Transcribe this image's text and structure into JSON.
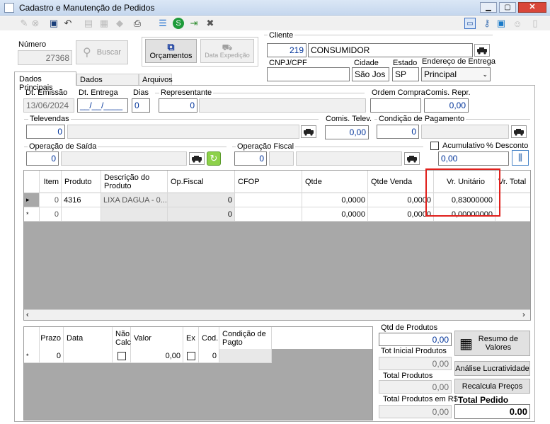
{
  "window": {
    "title": "Cadastro e Manutenção de Pedidos"
  },
  "search": {
    "numero_label": "Número",
    "numero_value": "27368",
    "buscar_label": "Buscar",
    "orcamentos_label": "Orçamentos",
    "data_expedicao_label": "Data Expedição"
  },
  "cliente": {
    "label": "Cliente",
    "code": "219",
    "name": "CONSUMIDOR",
    "cnpj_label": "CNPJ/CPF",
    "cnpj_value": "",
    "cidade_label": "Cidade",
    "cidade_value": "São Jos",
    "estado_label": "Estado",
    "estado_value": "SP",
    "endereco_label": "Endereço de Entrega",
    "endereco_value": "Principal"
  },
  "tabs": [
    "Dados Principais",
    "Dados Adicionais",
    "Arquivos"
  ],
  "form": {
    "dt_emissao_label": "Dt. Emissão",
    "dt_emissao": "13/06/2024",
    "dt_entrega_label": "Dt. Entrega",
    "dt_entrega": "__/__/____",
    "dias_label": "Dias",
    "dias": "0",
    "representante_label": "Representante",
    "representante": "0",
    "ordem_compra_label": "Ordem Compra",
    "ordem_compra": "",
    "comis_repr_label": "Comis. Repr.",
    "comis_repr": "0,00",
    "televendas_label": "Televendas",
    "televendas": "0",
    "comis_telev_label": "Comis. Telev.",
    "comis_telev": "0,00",
    "cond_pag_label": "Condição de Pagamento",
    "cond_pag": "0",
    "op_saida_label": "Operação de Saída",
    "op_saida": "0",
    "op_fiscal_label": "Operação Fiscal",
    "op_fiscal": "0",
    "acumulativo_label": "Acumulativo",
    "desconto_label": "% Desconto",
    "desconto": "0,00"
  },
  "items_grid": {
    "headers": [
      "Item",
      "Produto",
      "Descrição do Produto",
      "Op.Fiscal",
      "CFOP",
      "Qtde",
      "Qtde Venda",
      "Vr. Unitário",
      "Vr. Total"
    ],
    "rows": [
      {
        "marker": "▸",
        "item": "0",
        "produto": "4316",
        "descricao": "LIXA DAGUA - 0...",
        "opfiscal": "0",
        "cfop": "",
        "qtde": "0,0000",
        "qtde_venda": "0,0000",
        "vr_unit": "0,83000000",
        "vr_total": ""
      },
      {
        "marker": "*",
        "item": "0",
        "produto": "",
        "descricao": "",
        "opfiscal": "0",
        "cfop": "",
        "qtde": "0,0000",
        "qtde_venda": "0,0000",
        "vr_unit": "0,00000000",
        "vr_total": ""
      }
    ]
  },
  "pay_grid": {
    "headers": [
      "Prazo",
      "Data",
      "Não Calc",
      "Valor",
      "Ex",
      "Cod.",
      "Condição de Pagto"
    ],
    "row": {
      "marker": "*",
      "prazo": "0",
      "data": "",
      "valor": "0,00",
      "cod": "0"
    }
  },
  "totals": {
    "qtd_produtos_label": "Qtd de Produtos",
    "qtd_produtos": "0,00",
    "tot_inicial_label": "Tot Inicial Produtos",
    "tot_inicial": "0,00",
    "total_produtos_label": "Total Produtos",
    "total_produtos": "0,00",
    "total_produtos_rs_label": "Total Produtos em R$",
    "total_produtos_rs": "0,00",
    "total_pedido_label": "Total Pedido",
    "total_pedido": "0.00"
  },
  "buttons": {
    "resumo": "Resumo de Valores",
    "analise": "Análise Lucratividade",
    "recalcula": "Recalcula Preços"
  },
  "highlight_color": "#e0201c"
}
